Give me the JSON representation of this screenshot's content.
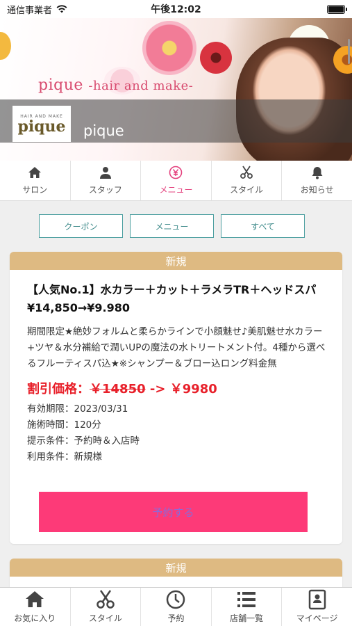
{
  "status_bar": {
    "carrier": "通信事業者",
    "time": "午後12:02"
  },
  "header": {
    "brand_title": "pique",
    "brand_subtitle": "-hair and make-",
    "logo_text": "pique",
    "logo_small": "HAIR AND MAKE",
    "shop_name": "pique"
  },
  "top_nav": [
    {
      "label": "サロン",
      "icon": "home-icon"
    },
    {
      "label": "スタッフ",
      "icon": "person-icon"
    },
    {
      "label": "メニュー",
      "icon": "yen-icon",
      "active": true
    },
    {
      "label": "スタイル",
      "icon": "scissors-icon"
    },
    {
      "label": "お知らせ",
      "icon": "bell-icon"
    }
  ],
  "filters": {
    "coupon": "クーポン",
    "menu": "メニュー",
    "all": "すべて"
  },
  "card1": {
    "label": "新規",
    "title": "【人気No.1】水カラー＋カット＋ラメラTR＋ヘッドスパ¥14,850→¥9.980",
    "description": "期間限定★絶妙フォルムと柔らかラインで小顔魅せ♪美肌魅せ水カラー+ツヤ＆水分補給で潤いUPの魔法の水トリートメント付。4種から選べるフルーティスパ込★※シャンプー＆ブロー込ロング料金無",
    "price_label": "割引価格：",
    "price_old": "￥14850",
    "price_arrow": " -> ",
    "price_new": "￥9980",
    "valid": "有効期限：2023/03/31",
    "duration": "施術時間：120分",
    "condition": "提示条件：予約時＆入店時",
    "usage": "利用条件：新規様",
    "reserve_button": "予約する"
  },
  "card2": {
    "label": "新規"
  },
  "tab_bar": [
    {
      "label": "お気に入り",
      "icon": "home-icon"
    },
    {
      "label": "スタイル",
      "icon": "scissors-icon"
    },
    {
      "label": "予約",
      "icon": "clock-icon"
    },
    {
      "label": "店舗一覧",
      "icon": "list-icon"
    },
    {
      "label": "マイページ",
      "icon": "profile-card-icon"
    }
  ],
  "colors": {
    "accent_pink": "#fd3a78",
    "tab_active": "#e4437f",
    "card_label": "#deba82",
    "filter_teal": "#4d9fa0",
    "price_red": "#e8202a"
  }
}
